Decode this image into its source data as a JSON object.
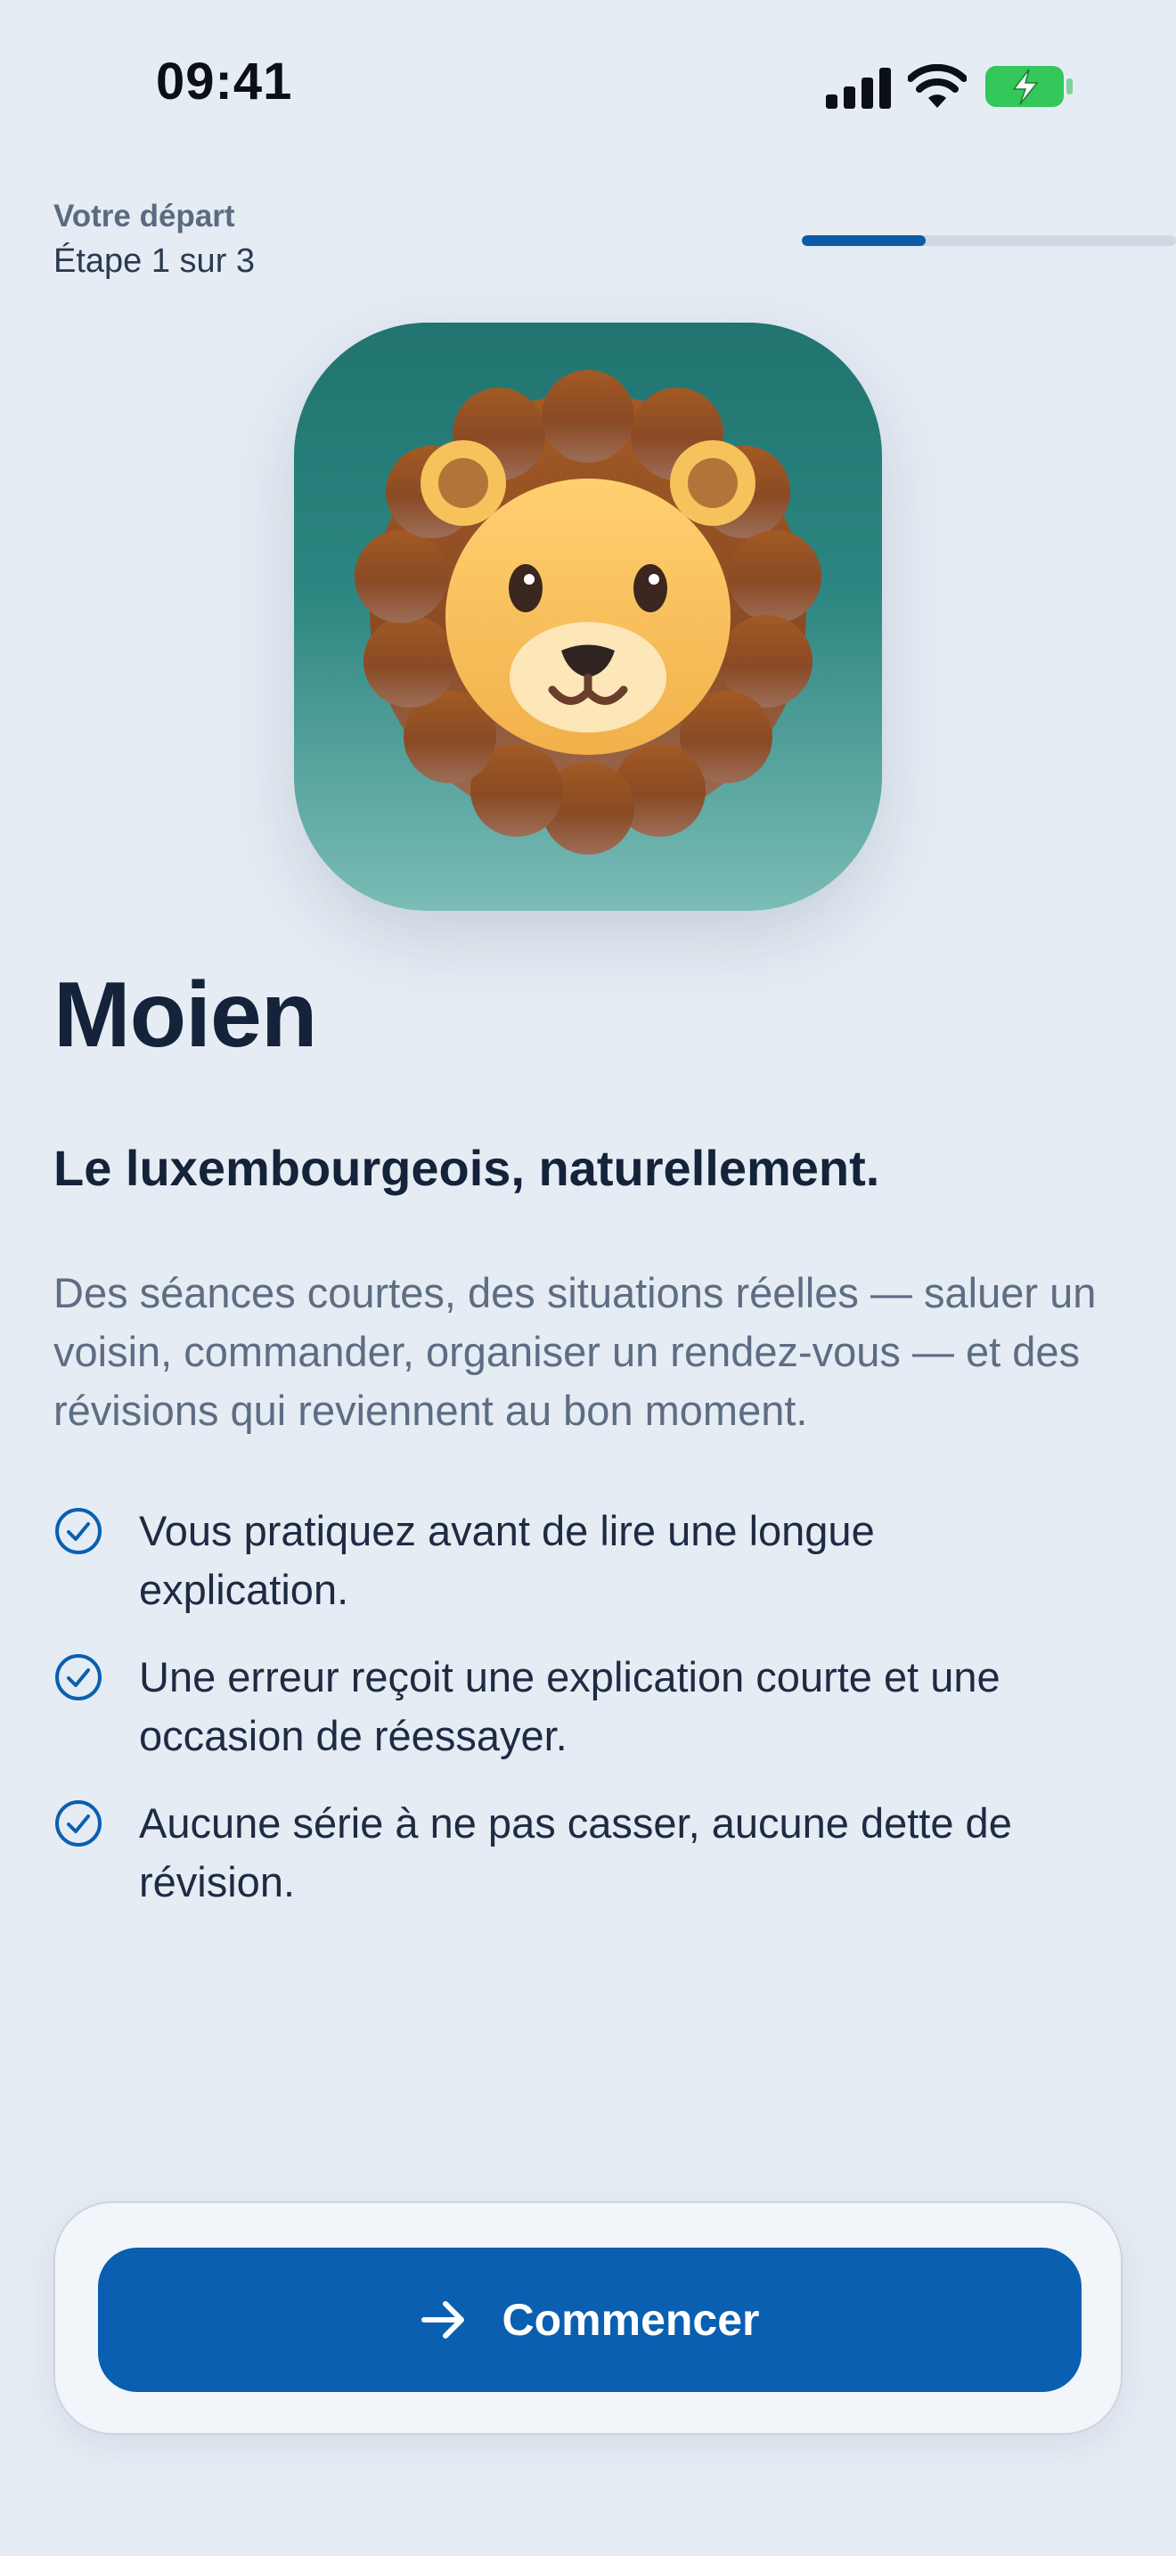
{
  "status_bar": {
    "time": "09:41",
    "icons": [
      "signal-icon",
      "wifi-icon",
      "battery-charging-icon"
    ]
  },
  "progress": {
    "title": "Votre départ",
    "step_label": "Étape 1 sur 3",
    "current_step": 1,
    "total_steps": 3,
    "fill_fraction": 0.33
  },
  "hero": {
    "icon": "lion-app-icon"
  },
  "main": {
    "title": "Moien",
    "subtitle": "Le luxembourgeois, naturellement.",
    "description": "Des séances courtes, des situations réelles — saluer un voisin, commander, organiser un rendez-vous — et des révisions qui reviennent au bon moment.",
    "features": [
      {
        "icon": "check-circle-icon",
        "text": "Vous pratiquez avant de lire une longue explication."
      },
      {
        "icon": "check-circle-icon",
        "text": "Une erreur reçoit une explication courte et une occasion de réessayer."
      },
      {
        "icon": "check-circle-icon",
        "text": "Aucune série à ne pas casser, aucune dette de révision."
      }
    ]
  },
  "cta": {
    "label": "Commencer",
    "icon": "arrow-right-icon"
  },
  "colors": {
    "background": "#e6ecf4",
    "accent": "#0a5fb0",
    "battery": "#34c759",
    "icon_teal": "#217470"
  }
}
